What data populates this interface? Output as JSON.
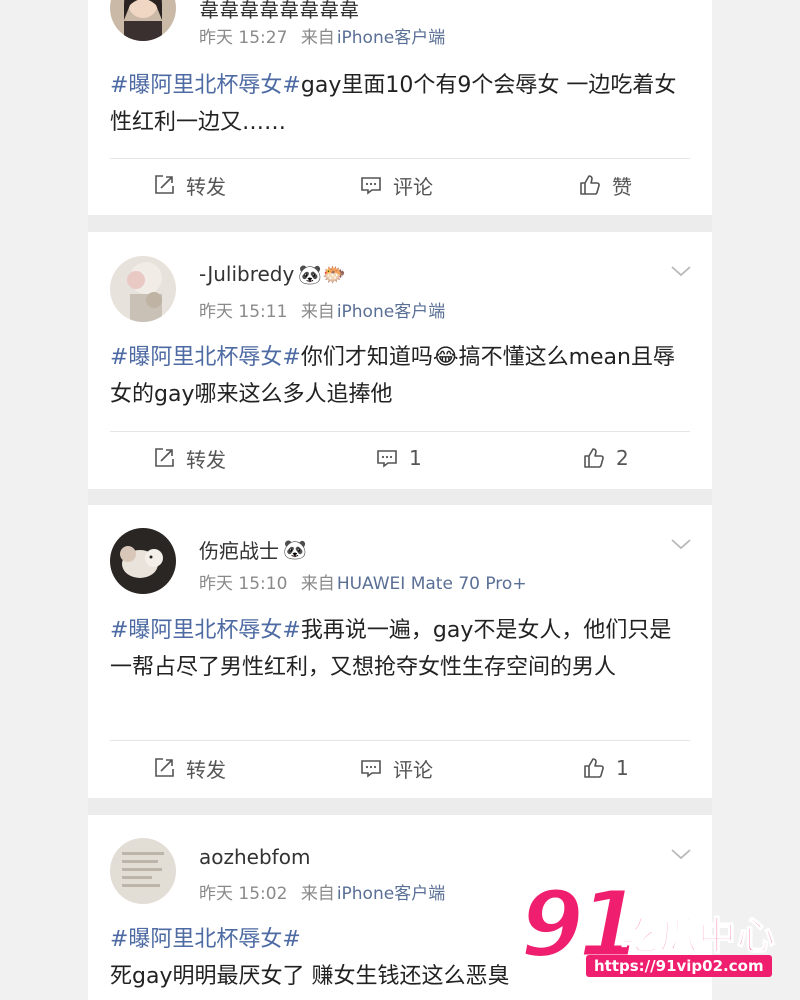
{
  "colors": {
    "accent_link": "#4d6aa3",
    "watermark": "#f01e6e"
  },
  "icons": {
    "repost": "share-edit-icon",
    "comment": "comment-icon",
    "like": "thumbs-up-icon",
    "more": "chevron-down-icon"
  },
  "posts": [
    {
      "username": "韋韋韋韋韋韋韋韋",
      "emojis": "",
      "time": "昨天 15:27",
      "from": "来自",
      "source": "iPhone客户端",
      "hashtag": "#曝阿里北杯辱女#",
      "text": "gay里面10个有9个会辱女 一边吃着女性红利一边又……",
      "repost_label": "转发",
      "comment_label": "评论",
      "like_label": "赞"
    },
    {
      "username": "-Julibredy",
      "emojis": "🐼🐡",
      "time": "昨天 15:11",
      "from": "来自",
      "source": "iPhone客户端",
      "hashtag": "#曝阿里北杯辱女#",
      "text": "你们才知道吗😂搞不懂这么mean且辱女的gay哪来这么多人追捧他",
      "repost_label": "转发",
      "comment_label": "1",
      "like_label": "2"
    },
    {
      "username": "伤疤战士",
      "emojis": "🐼",
      "time": "昨天 15:10",
      "from": "来自",
      "source": "HUAWEI Mate 70 Pro+",
      "hashtag": "#曝阿里北杯辱女#",
      "text": "我再说一遍，gay不是女人，他们只是一帮占尽了男性红利，又想抢夺女性生存空间的男人",
      "repost_label": "转发",
      "comment_label": "评论",
      "like_label": "1"
    },
    {
      "username": "aozhebfom",
      "emojis": "",
      "time": "昨天 15:02",
      "from": "来自",
      "source": "iPhone客户端",
      "hashtag": "#曝阿里北杯辱女#",
      "text": "死gay明明最厌女了 赚女生钱还这么恶臭"
    }
  ],
  "watermark": {
    "number": "91",
    "name": "吃瓜中心",
    "url": "https://91vip02.com"
  }
}
